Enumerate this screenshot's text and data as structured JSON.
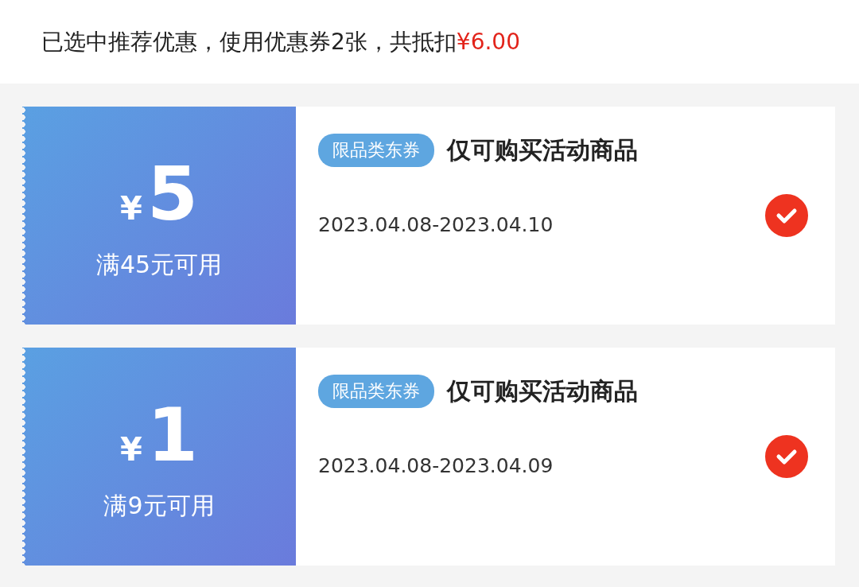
{
  "summary": {
    "text": "已选中推荐优惠，使用优惠券2张，共抵扣",
    "amount": "¥6.00"
  },
  "coupons": [
    {
      "currency": "¥",
      "amount": "5",
      "condition": "满45元可用",
      "tag": "限品类东券",
      "title": "仅可购买活动商品",
      "dates": "2023.04.08-2023.04.10",
      "selected": true
    },
    {
      "currency": "¥",
      "amount": "1",
      "condition": "满9元可用",
      "tag": "限品类东券",
      "title": "仅可购买活动商品",
      "dates": "2023.04.08-2023.04.09",
      "selected": true
    }
  ]
}
